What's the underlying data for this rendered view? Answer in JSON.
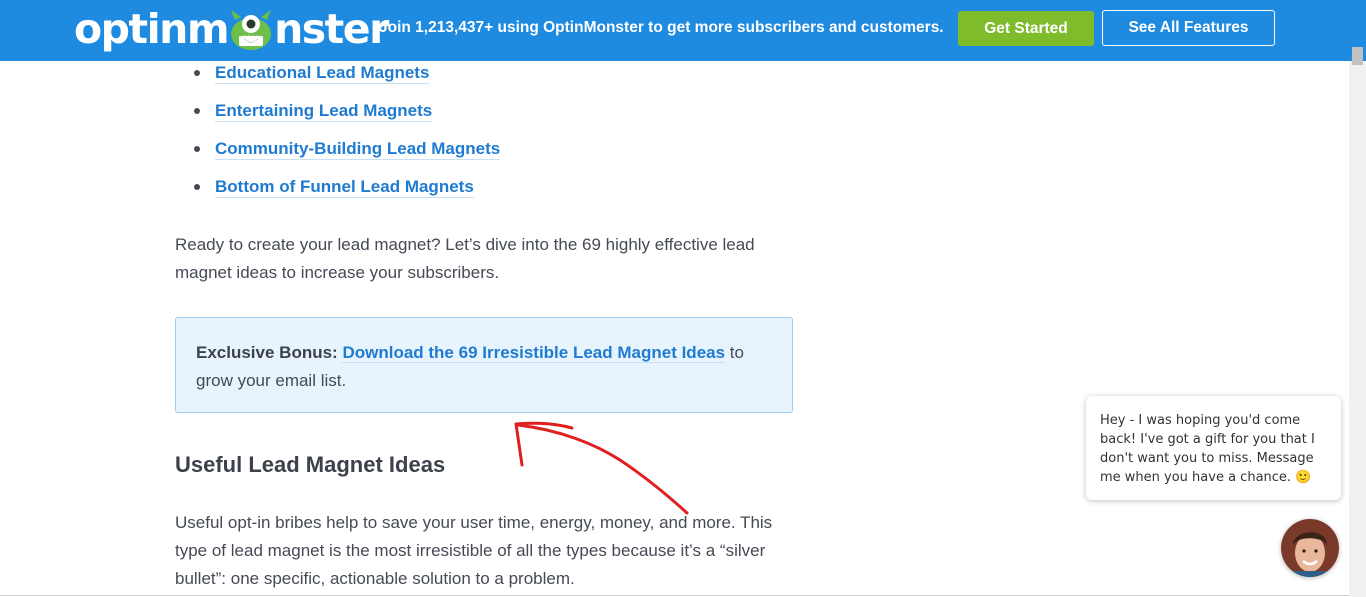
{
  "header": {
    "logo_left": "optinm",
    "logo_right": "nster",
    "promo": "Join 1,213,437+ using OptinMonster to get more subscribers and customers.",
    "get_started": "Get Started",
    "see_all": "See All Features"
  },
  "bullets": [
    "Educational Lead Magnets",
    "Entertaining Lead Magnets",
    "Community-Building Lead Magnets",
    "Bottom of Funnel Lead Magnets"
  ],
  "intro": "Ready to create your lead magnet? Let’s dive into the 69 highly effective lead magnet ideas to increase your subscribers.",
  "bonus": {
    "label": "Exclusive Bonus:",
    "link": "Download the 69 Irresistible Lead Magnet Ideas",
    "suffix": " to grow your email list."
  },
  "section_heading": "Useful Lead Magnet Ideas",
  "section_body": "Useful opt-in bribes help to save your user time, energy, money, and more. This type of lead magnet is the most irresistible of all the types because it’s a “silver bullet”: one specific, actionable solution to a problem.",
  "chat": {
    "message": "Hey - I was hoping you'd come back! I've got a gift for you that I don't want you to miss. Message me when you have a chance.",
    "emoji": "🙂"
  },
  "colors": {
    "brand_blue": "#1e8ae0",
    "cta_green": "#7ebc2c",
    "link_blue": "#1e7bd1",
    "annotation_red": "#e02020"
  }
}
